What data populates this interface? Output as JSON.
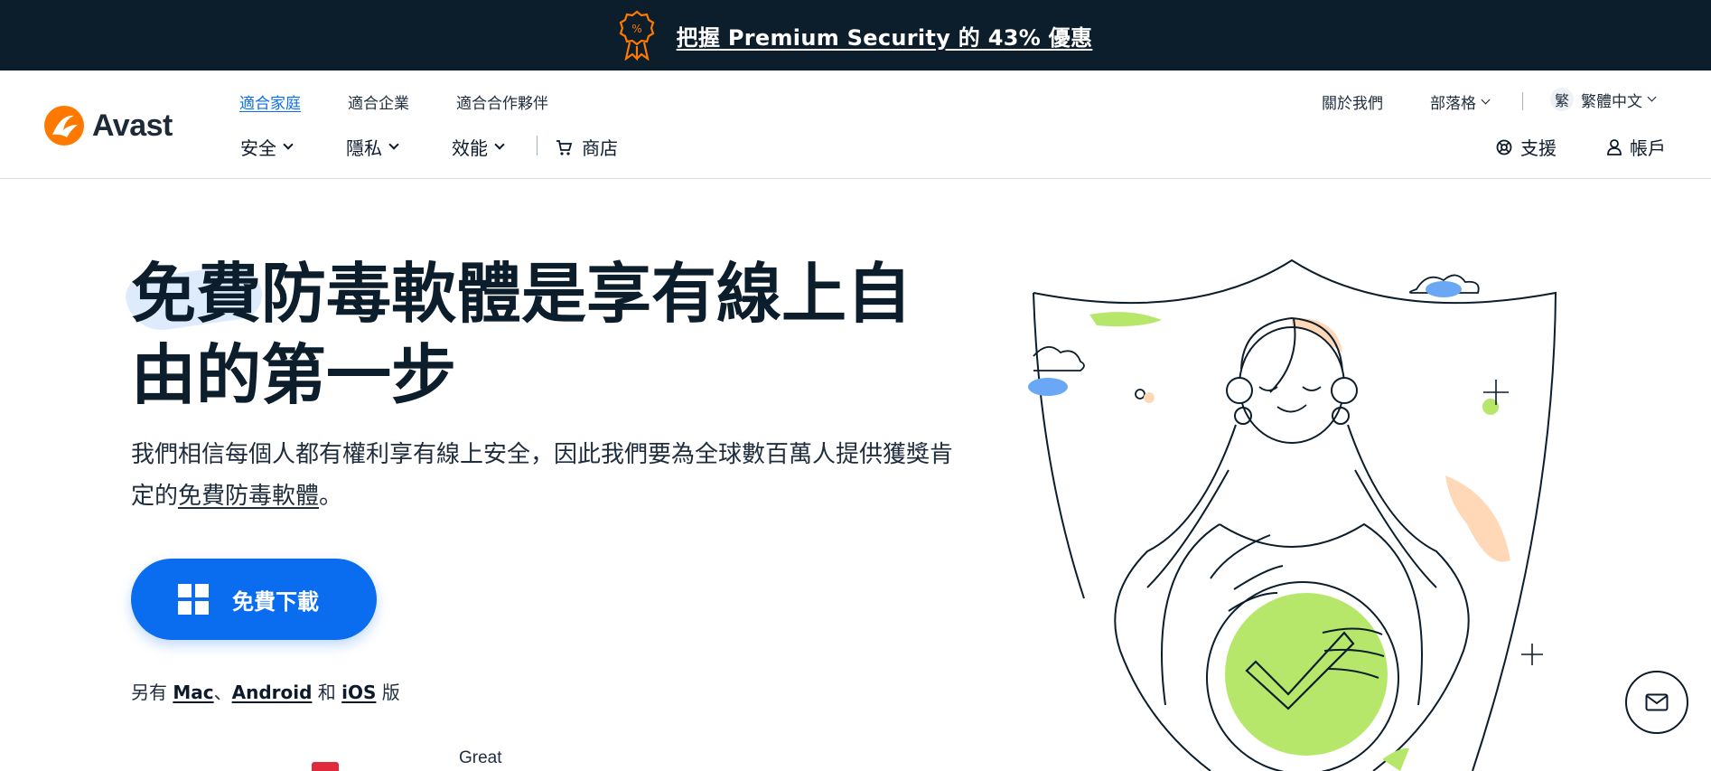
{
  "promo": {
    "text": "把握 Premium Security 的 43% 優惠"
  },
  "header": {
    "brand": "Avast",
    "segments": [
      "適合家庭",
      "適合企業",
      "適合合作夥伴"
    ],
    "main_nav": [
      "安全",
      "隱私",
      "效能"
    ],
    "store": "商店",
    "about": "關於我們",
    "blog": "部落格",
    "language_glyph": "繁",
    "language": "繁體中文",
    "support": "支援",
    "account": "帳戶"
  },
  "hero": {
    "headline": "免費防毒軟體是享有線上自由的第一步",
    "lead_text": "我們相信每個人都有權利享有線上安全，因此我們要為全球數百萬人提供獲獎肯定的",
    "lead_link": "免費防毒軟體",
    "lead_end": "。",
    "cta_label": "免費下載",
    "platforms_prefix": "另有 ",
    "platform_mac": "Mac",
    "sep1": "、",
    "platform_android": "Android",
    "platforms_and": " 和 ",
    "platform_ios": "iOS",
    "platforms_suffix": " 版",
    "rating_label": "Great"
  },
  "colors": {
    "brand_orange": "#ff7800",
    "primary_blue": "#0a6df0",
    "banner_dark": "#0c1d2b",
    "green": "#b6e76b",
    "peach": "#ffd8b8"
  },
  "icons": [
    "discount-badge-icon",
    "avast-logo-icon",
    "windows-icon",
    "cart-icon",
    "support-icon",
    "user-icon",
    "mail-icon"
  ]
}
